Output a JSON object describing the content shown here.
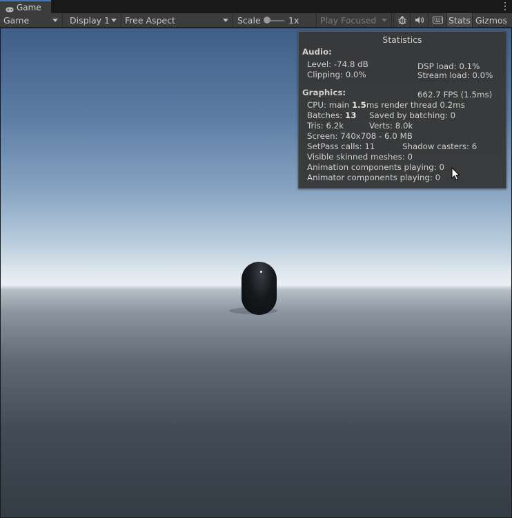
{
  "tab": {
    "label": "Game",
    "icon": "gamepad-icon"
  },
  "toolbar": {
    "view_mode": "Game",
    "display": "Display 1",
    "aspect": "Free Aspect",
    "scale_label": "Scale",
    "scale_value": "1x",
    "play_mode": "Play Focused",
    "stats_label": "Stats",
    "gizmos_label": "Gizmos",
    "icons": [
      "bug-icon",
      "speaker-icon",
      "keyboard-icon"
    ]
  },
  "stats": {
    "title": "Statistics",
    "audio_header": "Audio:",
    "level": "Level: -74.8 dB",
    "clipping": "Clipping: 0.0%",
    "dsp_load": "DSP load: 0.1%",
    "stream_load": "Stream load: 0.0%",
    "graphics_header": "Graphics:",
    "fps": "662.7 FPS (1.5ms)",
    "cpu_prefix": "CPU: main ",
    "cpu_main": "1.5",
    "cpu_suffix": "ms  render thread 0.2ms",
    "batches_prefix": "Batches: ",
    "batches": "13",
    "saved_by_batching": "Saved by batching: 0",
    "tris": "Tris: 6.2k",
    "verts": "Verts: 8.0k",
    "screen": "Screen: 740x708 - 6.0 MB",
    "setpass": "SetPass calls: 11",
    "shadow_casters": "Shadow casters: 6",
    "skinned_meshes": "Visible skinned meshes: 0",
    "animation_components": "Animation components playing: 0",
    "animator_components": "Animator components playing: 0"
  }
}
